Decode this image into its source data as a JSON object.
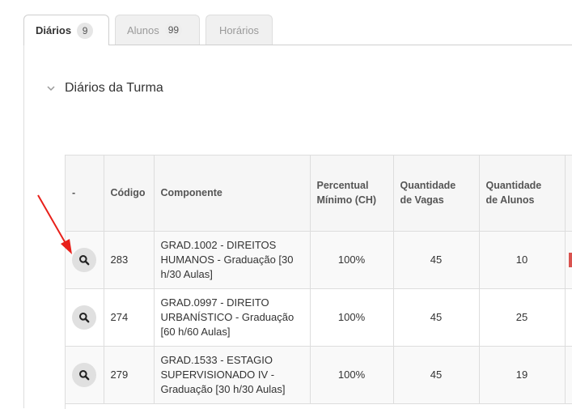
{
  "tabs": [
    {
      "label": "Diários",
      "count": "9",
      "active": true
    },
    {
      "label": "Alunos",
      "count": "99",
      "active": false
    },
    {
      "label": "Horários",
      "count": "",
      "active": false
    }
  ],
  "section": {
    "title": "Diários da Turma"
  },
  "table": {
    "headers": {
      "action": "-",
      "codigo": "Código",
      "componente": "Componente",
      "percentual_line1": "Percentual",
      "percentual_line2": "Mínimo (CH)",
      "vagas_line1": "Quantidade",
      "vagas_line2": "de Vagas",
      "alunos_line1": "Quantidade",
      "alunos_line2": "de Alunos"
    },
    "rows": [
      {
        "codigo": "283",
        "componente": "GRAD.1002 - DIREITOS HUMANOS - Graduação [30 h/30 Aulas]",
        "percentual": "100%",
        "vagas": "45",
        "alunos": "10"
      },
      {
        "codigo": "274",
        "componente": "GRAD.0997 - DIREITO URBANÍSTICO - Graduação [60 h/60 Aulas]",
        "percentual": "100%",
        "vagas": "45",
        "alunos": "25"
      },
      {
        "codigo": "279",
        "componente": "GRAD.1533 - ESTAGIO SUPERVISIONADO IV - Graduação [30 h/30 Aulas]",
        "percentual": "100%",
        "vagas": "45",
        "alunos": "19"
      }
    ]
  },
  "icons": {
    "view": "search-icon",
    "collapse": "chevron-down-icon"
  },
  "colors": {
    "annotation_arrow": "#e8201a",
    "status_mark": "#d9534f",
    "header_bg": "#f6f6f6"
  }
}
